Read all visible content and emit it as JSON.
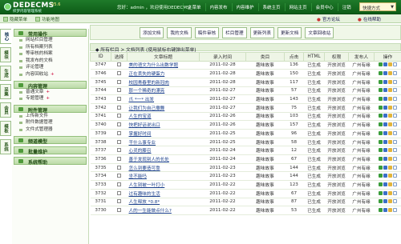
{
  "header": {
    "logo_text": "DEDECMS",
    "logo_version": "V5.6",
    "logo_sub": "织梦内容管理系统",
    "welcome": "您好：admin ，欢迎使用DEDECMS!",
    "nav": [
      "主菜单",
      "内容发布",
      "内容维护",
      "系统主页",
      "网站主页",
      "会员中心",
      "注销"
    ],
    "quick_label": "快捷方式"
  },
  "subbar": {
    "hide_menu": "隐藏菜单",
    "function_map": "功能地图",
    "official_forum": "官方论坛",
    "online_help": "在线帮助"
  },
  "side_tabs": [
    "核心",
    "模块",
    "生成",
    "采集",
    "会员",
    "模板",
    "系统"
  ],
  "menu": {
    "groups": [
      {
        "title": "常用操作",
        "items": [
          {
            "label": "网站栏目管理"
          },
          {
            "label": "所有档案列表"
          },
          {
            "label": "等审核的档案"
          },
          {
            "label": "我发布的文档"
          },
          {
            "label": "评论管理"
          },
          {
            "label": "内容回收站",
            "add": "+"
          }
        ]
      },
      {
        "title": "内容管理",
        "items": [
          {
            "label": "普通文章",
            "add": "+"
          },
          {
            "label": "专题管理",
            "add": "+"
          }
        ]
      },
      {
        "title": "附件管理",
        "items": [
          {
            "label": "上传新文件"
          },
          {
            "label": "附件数据管理"
          },
          {
            "label": "文件式管理器"
          }
        ]
      },
      {
        "title": "频道模型",
        "items": []
      },
      {
        "title": "批量维护",
        "items": []
      },
      {
        "title": "系统帮助",
        "items": []
      }
    ]
  },
  "toolbar": [
    "添加文档",
    "我的文档",
    "稿件审核",
    "栏目管理",
    "更新列表",
    "更新文档",
    "文章回收站"
  ],
  "list_title": "◆ 所有栏目 > 文档列表 (使用鼠标右键弹出菜单)",
  "table": {
    "headers": [
      "ID",
      "选择",
      "文章标题",
      "录入时间",
      "类目",
      "点击",
      "HTML",
      "权限",
      "发布人",
      "操作"
    ],
    "rows": [
      {
        "id": "3747",
        "title": "美的语文为什么出数学题",
        "date": "2011-02-28",
        "cat": "趣味故事",
        "hits": "136",
        "html": "已生成",
        "perm": "开放浏览",
        "author": "广州有缘"
      },
      {
        "id": "3746",
        "title": "正在丢失的硬蛋力",
        "date": "2011-02-28",
        "cat": "趣味故事",
        "hits": "150",
        "html": "已生成",
        "perm": "开放浏览",
        "author": "广州有缘"
      },
      {
        "id": "3745",
        "title": "校园青春里的新冠肉",
        "date": "2011-02-28",
        "cat": "趣味故事",
        "hits": "117",
        "html": "已生成",
        "perm": "开放浏览",
        "author": "广州有缘"
      },
      {
        "id": "3744",
        "title": "那一个稀奇的漂亮",
        "date": "2011-02-27",
        "cat": "趣味故事",
        "hits": "57",
        "html": "已生成",
        "perm": "开放浏览",
        "author": "广州有缘"
      },
      {
        "id": "3743",
        "title": "爪 *一* 出发",
        "date": "2011-02-27",
        "cat": "趣味故事",
        "hits": "143",
        "html": "已生成",
        "perm": "开放浏览",
        "author": "广州有缘"
      },
      {
        "id": "3742",
        "title": "让我们为自己撒舞",
        "date": "2011-02-27",
        "cat": "趣味故事",
        "hits": "75",
        "html": "已生成",
        "perm": "开放浏览",
        "author": "广州有缘"
      },
      {
        "id": "3741",
        "title": "人生的宝道",
        "date": "2011-02-26",
        "cat": "趣味故事",
        "hits": "103",
        "html": "已生成",
        "perm": "开放浏览",
        "author": "广州有缘"
      },
      {
        "id": "3740",
        "title": "快把好话说出口",
        "date": "2011-02-26",
        "cat": "趣味故事",
        "hits": "157",
        "html": "已生成",
        "perm": "开放浏览",
        "author": "广州有缘"
      },
      {
        "id": "3739",
        "title": "掌握好时间",
        "date": "2011-02-25",
        "cat": "趣味故事",
        "hits": "96",
        "html": "已生成",
        "perm": "开放浏览",
        "author": "广州有缘"
      },
      {
        "id": "3738",
        "title": "干什么事专业",
        "date": "2011-02-25",
        "cat": "趣味故事",
        "hits": "58",
        "html": "已生成",
        "perm": "开放浏览",
        "author": "广州有缘"
      },
      {
        "id": "3737",
        "title": "心灵的藤召",
        "date": "2011-02-24",
        "cat": "趣味故事",
        "hits": "12",
        "html": "已生成",
        "perm": "开放浏览",
        "author": "广州有缘"
      },
      {
        "id": "3736",
        "title": "善于发现别人的长处",
        "date": "2011-02-24",
        "cat": "趣味故事",
        "hits": "67",
        "html": "已生成",
        "perm": "开放浏览",
        "author": "广州有缘"
      },
      {
        "id": "3735",
        "title": "怎么到要造可靠",
        "date": "2011-02-23",
        "cat": "趣味故事",
        "hits": "144",
        "html": "已生成",
        "perm": "开放浏览",
        "author": "广州有缘"
      },
      {
        "id": "3734",
        "title": "坐不能吗",
        "date": "2011-02-23",
        "cat": "趣味故事",
        "hits": "144",
        "html": "已生成",
        "perm": "开放浏览",
        "author": "广州有缘"
      },
      {
        "id": "3733",
        "title": "人生别被一叶打小",
        "date": "2011-02-22",
        "cat": "趣味故事",
        "hits": "123",
        "html": "已生成",
        "perm": "开放浏览",
        "author": "广州有缘"
      },
      {
        "id": "3732",
        "title": "过有趣味的生活",
        "date": "2011-02-22",
        "cat": "趣味故事",
        "hits": "67",
        "html": "已生成",
        "perm": "开放浏览",
        "author": "广州有缘"
      },
      {
        "id": "3731",
        "title": "人生释放 *0.8*",
        "date": "2011-02-22",
        "cat": "趣味故事",
        "hits": "87",
        "html": "已生成",
        "perm": "开放浏览",
        "author": "广州有缘"
      },
      {
        "id": "3730",
        "title": "人的一生能做点什么?",
        "date": "2011-02-22",
        "cat": "趣味故事",
        "hits": "53",
        "html": "已生成",
        "perm": "开放浏览",
        "author": "广州有缘"
      }
    ]
  },
  "icons": {
    "row_actions": [
      "edit-icon",
      "view-icon",
      "delete-icon",
      "attachment-icon"
    ],
    "colors": {
      "header_green": "#1f7a2a",
      "link_blue": "#1a3f8a",
      "accent_red": "#cc3333"
    }
  }
}
